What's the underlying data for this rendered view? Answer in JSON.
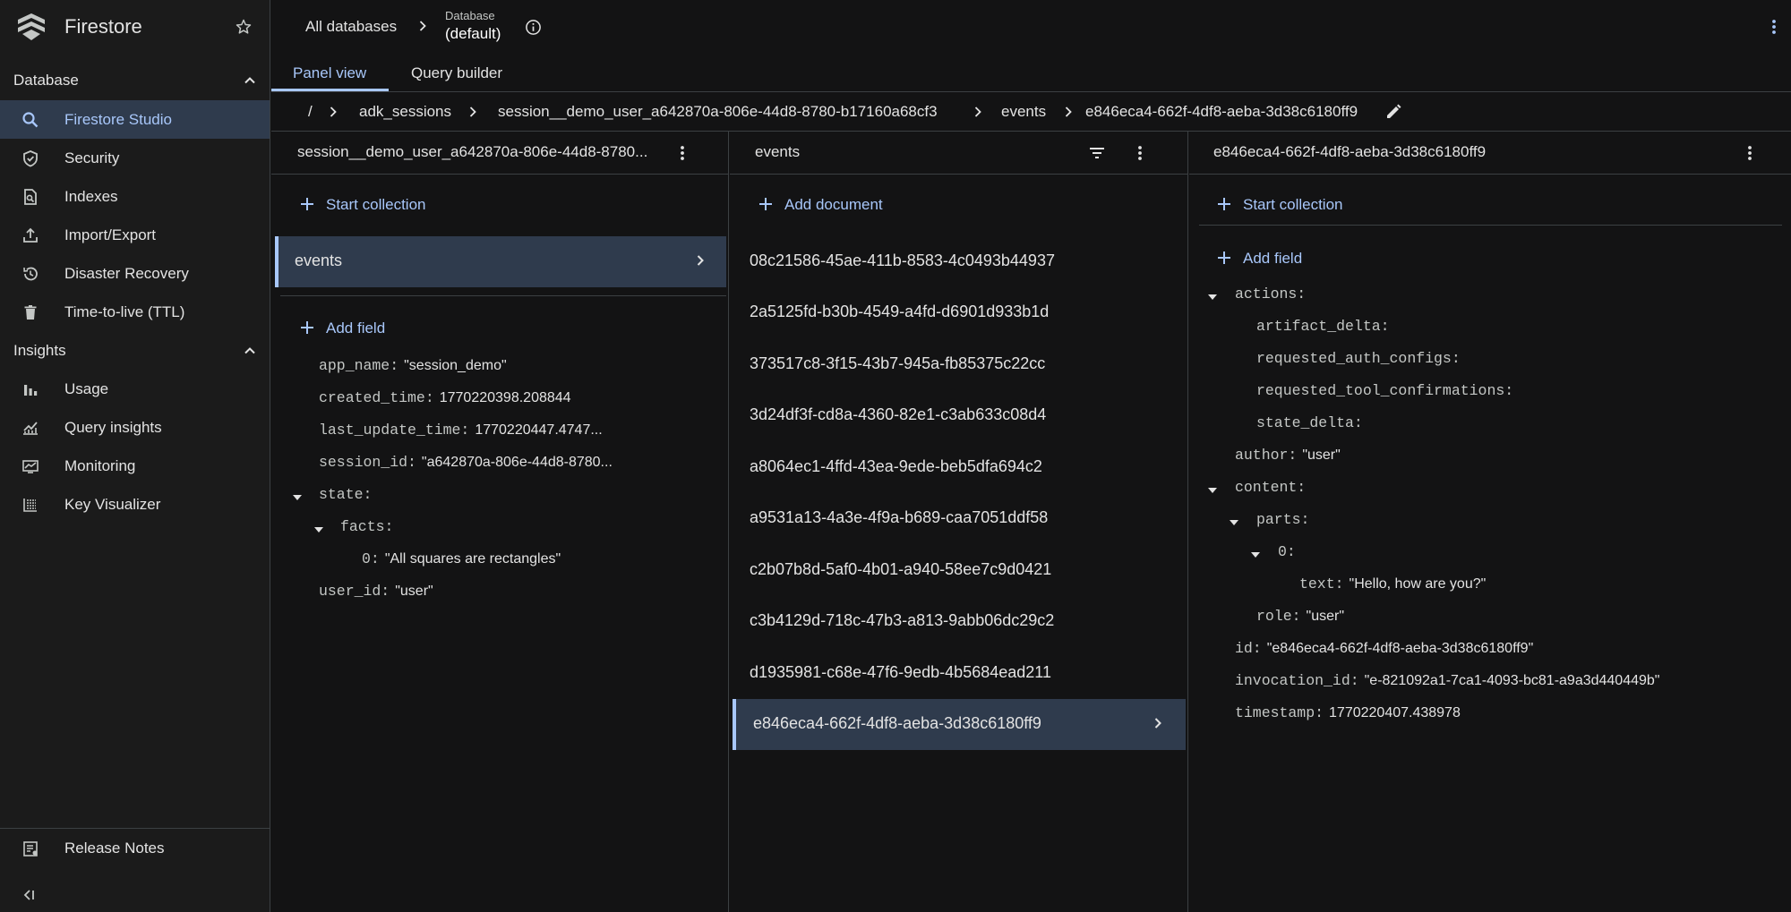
{
  "app": {
    "title": "Firestore"
  },
  "sidebar": {
    "database_section": "Database",
    "database_items": [
      {
        "label": "Firestore Studio",
        "icon": "search-icon"
      },
      {
        "label": "Security",
        "icon": "shield-icon"
      },
      {
        "label": "Indexes",
        "icon": "indexes-icon"
      },
      {
        "label": "Import/Export",
        "icon": "upload-icon"
      },
      {
        "label": "Disaster Recovery",
        "icon": "history-icon"
      },
      {
        "label": "Time-to-live (TTL)",
        "icon": "trash-icon"
      }
    ],
    "insights_section": "Insights",
    "insights_items": [
      {
        "label": "Usage",
        "icon": "bar-chart-icon"
      },
      {
        "label": "Query insights",
        "icon": "query-insights-icon"
      },
      {
        "label": "Monitoring",
        "icon": "monitoring-icon"
      },
      {
        "label": "Key Visualizer",
        "icon": "key-visualizer-icon"
      }
    ],
    "release_notes": "Release Notes"
  },
  "topbar": {
    "all_databases": "All databases",
    "database_label": "Database",
    "database_name": "(default)"
  },
  "tabs": [
    "Panel view",
    "Query builder"
  ],
  "path": {
    "root": "/",
    "segments": [
      "adk_sessions",
      "session__demo_user_a642870a-806e-44d8-8780-b17160a68cf3",
      "events",
      "e846eca4-662f-4df8-aeba-3d38c6180ff9"
    ]
  },
  "panel1": {
    "title": "session__demo_user_a642870a-806e-44d8-8780...",
    "start_collection": "Start collection",
    "collection": "events",
    "add_field": "Add field",
    "fields": {
      "app_name_k": "app_name:",
      "app_name_v": "\"session_demo\"",
      "created_time_k": "created_time:",
      "created_time_v": "1770220398.208844",
      "last_update_time_k": "last_update_time:",
      "last_update_time_v": "1770220447.4747...",
      "session_id_k": "session_id:",
      "session_id_v": "\"a642870a-806e-44d8-8780...",
      "state_k": "state:",
      "facts_k": "facts:",
      "fact0_k": "0:",
      "fact0_v": "\"All squares are rectangles\"",
      "user_id_k": "user_id:",
      "user_id_v": "\"user\""
    }
  },
  "panel2": {
    "title": "events",
    "add_document": "Add document",
    "documents": [
      "08c21586-45ae-411b-8583-4c0493b44937",
      "2a5125fd-b30b-4549-a4fd-d6901d933b1d",
      "373517c8-3f15-43b7-945a-fb85375c22cc",
      "3d24df3f-cd8a-4360-82e1-c3ab633c08d4",
      "a8064ec1-4ffd-43ea-9ede-beb5dfa694c2",
      "a9531a13-4a3e-4f9a-b689-caa7051ddf58",
      "c2b07b8d-5af0-4b01-a940-58ee7c9d0421",
      "c3b4129d-718c-47b3-a813-9abb06dc29c2",
      "d1935981-c68e-47f6-9edb-4b5684ead211"
    ],
    "selected": "e846eca4-662f-4df8-aeba-3d38c6180ff9"
  },
  "panel3": {
    "title": "e846eca4-662f-4df8-aeba-3d38c6180ff9",
    "start_collection": "Start collection",
    "add_field": "Add field",
    "fields": {
      "actions_k": "actions:",
      "artifact_delta_k": "artifact_delta:",
      "requested_auth_configs_k": "requested_auth_configs:",
      "requested_tool_confirmations_k": "requested_tool_confirmations:",
      "state_delta_k": "state_delta:",
      "author_k": "author:",
      "author_v": "\"user\"",
      "content_k": "content:",
      "parts_k": "parts:",
      "part0_k": "0:",
      "text_k": "text:",
      "text_v": "\"Hello, how are you?\"",
      "role_k": "role:",
      "role_v": "\"user\"",
      "id_k": "id:",
      "id_v": "\"e846eca4-662f-4df8-aeba-3d38c6180ff9\"",
      "invocation_id_k": "invocation_id:",
      "invocation_id_v": "\"e-821092a1-7ca1-4093-bc81-a9a3d440449b\"",
      "timestamp_k": "timestamp:",
      "timestamp_v": "1770220407.438978"
    }
  },
  "colors": {
    "accent": "#a8c7fa",
    "selected_bg": "#2f3b4d",
    "background": "#131314",
    "sidebar_bg": "#1b1b1b"
  }
}
